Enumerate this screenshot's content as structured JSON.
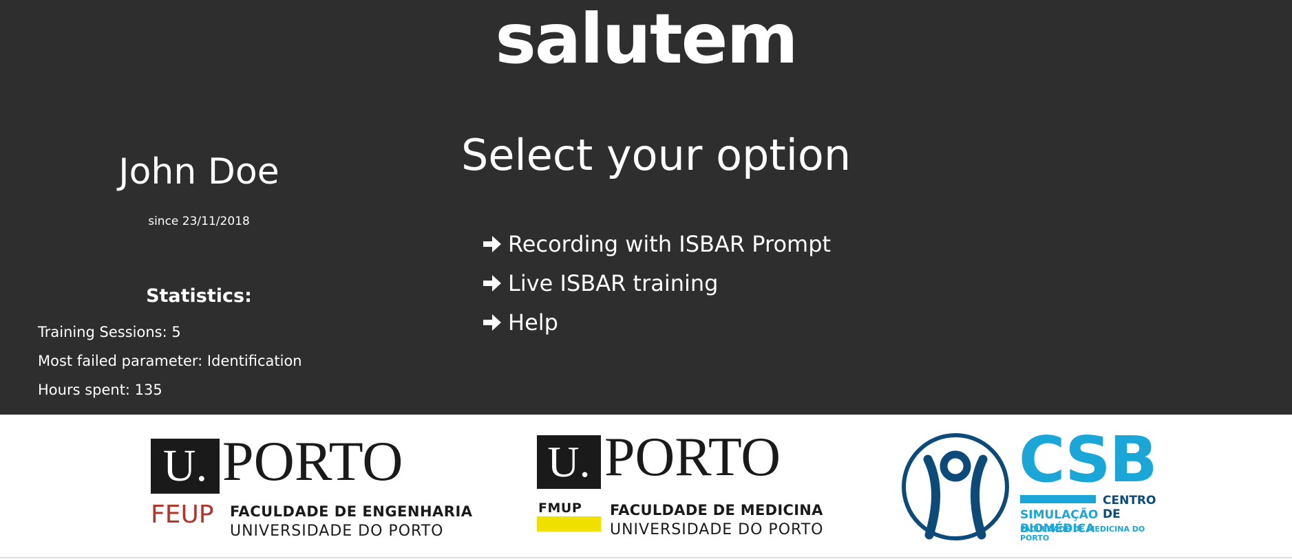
{
  "app": {
    "title": "salutem"
  },
  "user": {
    "name": "John Doe",
    "since": "since 23/11/2018"
  },
  "stats": {
    "heading": "Statistics:",
    "items": [
      "Training Sessions: 5",
      "Most failed parameter: Identification",
      "Hours spent: 135"
    ]
  },
  "menu": {
    "heading": "Select your option",
    "items": [
      {
        "label": "Recording with ISBAR Prompt",
        "icon": "arrow-right-icon"
      },
      {
        "label": "Live ISBAR training",
        "icon": "arrow-right-icon"
      },
      {
        "label": "Help",
        "icon": "arrow-right-icon"
      }
    ]
  },
  "logos": {
    "feup": {
      "u": "U.",
      "porto": "PORTO",
      "abbr": "FEUP",
      "line1": "FACULDADE DE ENGENHARIA",
      "line2": "UNIVERSIDADE DO PORTO"
    },
    "fmup": {
      "u": "U.",
      "porto": "PORTO",
      "abbr": "FMUP",
      "line1": "FACULDADE DE MEDICINA",
      "line2": "UNIVERSIDADE DO PORTO"
    },
    "csb": {
      "abbr": "CSB",
      "line1": "CENTRO DE",
      "line2": "SIMULAÇÃO BIOMÉDICA",
      "line3": "FACULDADE DE MEDICINA DO PORTO"
    }
  },
  "colors": {
    "header_bg": "#2e2e2e",
    "text": "#ffffff",
    "feup_red": "#b5342a",
    "fmup_yellow": "#f0e000",
    "csb_cyan": "#1aa7d8",
    "csb_navy": "#0c4a7a"
  }
}
